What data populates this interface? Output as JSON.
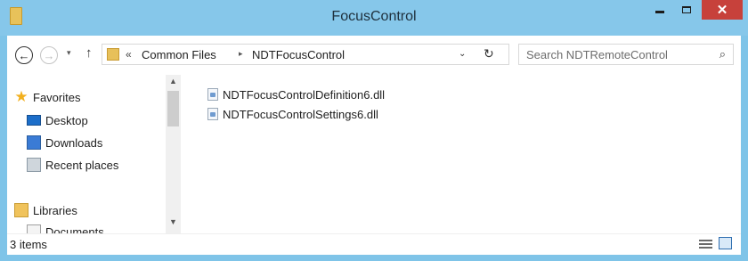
{
  "window": {
    "title": "FocusControl",
    "close_glyph": "✕"
  },
  "nav": {
    "back_glyph": "←",
    "forward_glyph": "→",
    "recent_glyph": "▾",
    "up_glyph": "↑"
  },
  "address": {
    "overflow_glyph": "«",
    "crumbs": [
      "Common Files",
      "NDTFocusControl"
    ],
    "separator_glyph": "▸",
    "dropdown_glyph": "⌄",
    "refresh_glyph": "↻"
  },
  "search": {
    "placeholder": "Search NDTRemoteControl",
    "icon_glyph": "⌕"
  },
  "sidebar": {
    "items": [
      {
        "label": "Favorites",
        "icon": "star-icon",
        "glyph": "★"
      },
      {
        "label": "Desktop",
        "icon": "desktop-icon"
      },
      {
        "label": "Downloads",
        "icon": "downloads-icon"
      },
      {
        "label": "Recent places",
        "icon": "recent-places-icon"
      },
      {
        "label": "Libraries",
        "icon": "libraries-icon"
      },
      {
        "label": "Documents",
        "icon": "documents-icon"
      }
    ]
  },
  "scrollbar": {
    "up_glyph": "▲",
    "down_glyph": "▼"
  },
  "files": [
    {
      "name": "NDTFocusControlDefinition6.dll",
      "icon": "dll-file-icon"
    },
    {
      "name": "NDTFocusControlSettings6.dll",
      "icon": "dll-file-icon"
    }
  ],
  "status": {
    "item_count": "3 items"
  },
  "colors": {
    "titlebar": "#86c7ea",
    "close": "#c7413b",
    "folder": "#e7c05a"
  }
}
